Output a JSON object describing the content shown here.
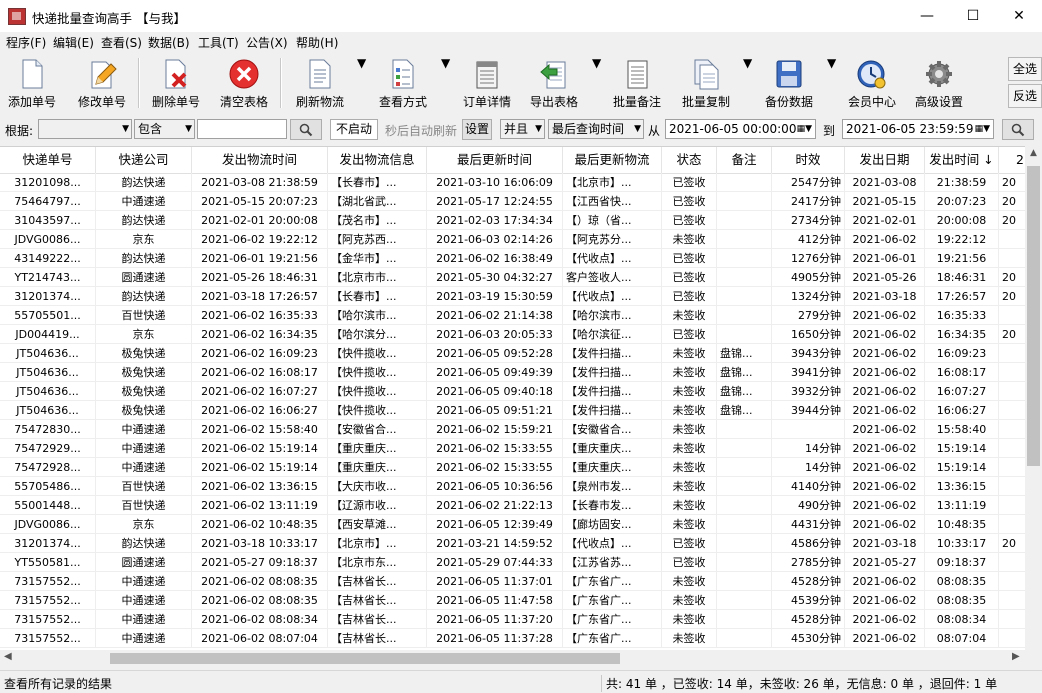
{
  "window": {
    "title": "快递批量查询高手 【与我】",
    "minimize": "—",
    "maximize": "☐",
    "close": "✕"
  },
  "menu": [
    "程序(F)",
    "编辑(E)",
    "查看(S)",
    "数据(B)",
    "工具(T)",
    "公告(X)",
    "帮助(H)"
  ],
  "toolbar": [
    {
      "id": "add",
      "label": "添加单号",
      "icon": "add-document-icon"
    },
    {
      "id": "edit",
      "label": "修改单号",
      "icon": "edit-pencil-icon"
    },
    {
      "id": "delete",
      "label": "删除单号",
      "icon": "delete-document-icon"
    },
    {
      "id": "clear",
      "label": "清空表格",
      "icon": "clear-table-icon"
    },
    {
      "id": "refresh",
      "label": "刷新物流",
      "icon": "refresh-document-icon"
    },
    {
      "id": "view",
      "label": "查看方式",
      "icon": "view-mode-icon"
    },
    {
      "id": "details",
      "label": "订单详情",
      "icon": "order-details-icon"
    },
    {
      "id": "export",
      "label": "导出表格",
      "icon": "export-table-icon"
    },
    {
      "id": "batchnote",
      "label": "批量备注",
      "icon": "batch-note-icon"
    },
    {
      "id": "batchcopy",
      "label": "批量复制",
      "icon": "batch-copy-icon"
    },
    {
      "id": "backup",
      "label": "备份数据",
      "icon": "backup-disk-icon"
    },
    {
      "id": "member",
      "label": "会员中心",
      "icon": "member-clock-icon"
    },
    {
      "id": "settings",
      "label": "高级设置",
      "icon": "gear-icon"
    }
  ],
  "side_buttons": {
    "select_all": "全选",
    "invert": "反选"
  },
  "filter": {
    "basis_label": "根据:",
    "basis_value": "",
    "match_value": "包含",
    "search_value": "",
    "auto_refresh_button": "不启动",
    "auto_refresh_text": "秒后自动刷新",
    "settings_button": "设置",
    "logic_value": "并且",
    "time_field_value": "最后查询时间",
    "from_label": "从",
    "from_value": "2021-06-05 00:00:00",
    "to_label": "到",
    "to_value": "2021-06-05 23:59:59"
  },
  "table": {
    "columns": [
      "快递单号",
      "快递公司",
      "发出物流时间",
      "发出物流信息",
      "最后更新时间",
      "最后更新物流",
      "状态",
      "备注",
      "时效",
      "发出日期",
      "发出时间 ↓",
      "2"
    ],
    "rows": [
      [
        "31201098...",
        "韵达快递",
        "2021-03-08 21:38:59",
        "【长春市】...",
        "2021-03-10 16:06:09",
        "【北京市】...",
        "已签收",
        "",
        "2547分钟",
        "2021-03-08",
        "21:38:59",
        "20"
      ],
      [
        "75464797...",
        "中通速递",
        "2021-05-15 20:07:23",
        "【湖北省武...",
        "2021-05-17 12:24:55",
        "【江西省快...",
        "已签收",
        "",
        "2417分钟",
        "2021-05-15",
        "20:07:23",
        "20"
      ],
      [
        "31043597...",
        "韵达快递",
        "2021-02-01 20:00:08",
        "【茂名市】...",
        "2021-02-03 17:34:34",
        "【）琼（省...",
        "已签收",
        "",
        "2734分钟",
        "2021-02-01",
        "20:00:08",
        "20"
      ],
      [
        "JDVG0086...",
        "京东",
        "2021-06-02 19:22:12",
        "【阿克苏西...",
        "2021-06-03 02:14:26",
        "【阿克苏分...",
        "未签收",
        "",
        "412分钟",
        "2021-06-02",
        "19:22:12",
        ""
      ],
      [
        "43149222...",
        "韵达快递",
        "2021-06-01 19:21:56",
        "【金华市】...",
        "2021-06-02 16:38:49",
        "【代收点】...",
        "已签收",
        "",
        "1276分钟",
        "2021-06-01",
        "19:21:56",
        ""
      ],
      [
        "YT214743...",
        "圆通速递",
        "2021-05-26 18:46:31",
        "【北京市市...",
        "2021-05-30 04:32:27",
        "客户签收人...",
        "已签收",
        "",
        "4905分钟",
        "2021-05-26",
        "18:46:31",
        "20"
      ],
      [
        "31201374...",
        "韵达快递",
        "2021-03-18 17:26:57",
        "【长春市】...",
        "2021-03-19 15:30:59",
        "【代收点】...",
        "已签收",
        "",
        "1324分钟",
        "2021-03-18",
        "17:26:57",
        "20"
      ],
      [
        "55705501...",
        "百世快递",
        "2021-06-02 16:35:33",
        "【哈尔滨市...",
        "2021-06-02 21:14:38",
        "【哈尔滨市...",
        "未签收",
        "",
        "279分钟",
        "2021-06-02",
        "16:35:33",
        ""
      ],
      [
        "JD004419...",
        "京东",
        "2021-06-02 16:34:35",
        "【哈尔滨分...",
        "2021-06-03 20:05:33",
        "【哈尔滨征...",
        "已签收",
        "",
        "1650分钟",
        "2021-06-02",
        "16:34:35",
        "20"
      ],
      [
        "JT504636...",
        "极兔快递",
        "2021-06-02 16:09:23",
        "【快件揽收...",
        "2021-06-05 09:52:28",
        "【发件扫描...",
        "未签收",
        "盘锦...",
        "3943分钟",
        "2021-06-02",
        "16:09:23",
        ""
      ],
      [
        "JT504636...",
        "极兔快递",
        "2021-06-02 16:08:17",
        "【快件揽收...",
        "2021-06-05 09:49:39",
        "【发件扫描...",
        "未签收",
        "盘锦...",
        "3941分钟",
        "2021-06-02",
        "16:08:17",
        ""
      ],
      [
        "JT504636...",
        "极兔快递",
        "2021-06-02 16:07:27",
        "【快件揽收...",
        "2021-06-05 09:40:18",
        "【发件扫描...",
        "未签收",
        "盘锦...",
        "3932分钟",
        "2021-06-02",
        "16:07:27",
        ""
      ],
      [
        "JT504636...",
        "极兔快递",
        "2021-06-02 16:06:27",
        "【快件揽收...",
        "2021-06-05 09:51:21",
        "【发件扫描...",
        "未签收",
        "盘锦...",
        "3944分钟",
        "2021-06-02",
        "16:06:27",
        ""
      ],
      [
        "75472830...",
        "中通速递",
        "2021-06-02 15:58:40",
        "【安徽省合...",
        "2021-06-02 15:59:21",
        "【安徽省合...",
        "未签收",
        "",
        "",
        "2021-06-02",
        "15:58:40",
        ""
      ],
      [
        "75472929...",
        "中通速递",
        "2021-06-02 15:19:14",
        "【重庆重庆...",
        "2021-06-02 15:33:55",
        "【重庆重庆...",
        "未签收",
        "",
        "14分钟",
        "2021-06-02",
        "15:19:14",
        ""
      ],
      [
        "75472928...",
        "中通速递",
        "2021-06-02 15:19:14",
        "【重庆重庆...",
        "2021-06-02 15:33:55",
        "【重庆重庆...",
        "未签收",
        "",
        "14分钟",
        "2021-06-02",
        "15:19:14",
        ""
      ],
      [
        "55705486...",
        "百世快递",
        "2021-06-02 13:36:15",
        "【大庆市收...",
        "2021-06-05 10:36:56",
        "【泉州市发...",
        "未签收",
        "",
        "4140分钟",
        "2021-06-02",
        "13:36:15",
        ""
      ],
      [
        "55001448...",
        "百世快递",
        "2021-06-02 13:11:19",
        "【辽源市收...",
        "2021-06-02 21:22:13",
        "【长春市发...",
        "未签收",
        "",
        "490分钟",
        "2021-06-02",
        "13:11:19",
        ""
      ],
      [
        "JDVG0086...",
        "京东",
        "2021-06-02 10:48:35",
        "【西安草滩...",
        "2021-06-05 12:39:49",
        "【廊坊固安...",
        "未签收",
        "",
        "4431分钟",
        "2021-06-02",
        "10:48:35",
        ""
      ],
      [
        "31201374...",
        "韵达快递",
        "2021-03-18 10:33:17",
        "【北京市】...",
        "2021-03-21 14:59:52",
        "【代收点】...",
        "已签收",
        "",
        "4586分钟",
        "2021-03-18",
        "10:33:17",
        "20"
      ],
      [
        "YT550581...",
        "圆通速递",
        "2021-05-27 09:18:37",
        "【北京市东...",
        "2021-05-29 07:44:33",
        "【江苏省苏...",
        "已签收",
        "",
        "2785分钟",
        "2021-05-27",
        "09:18:37",
        ""
      ],
      [
        "73157552...",
        "中通速递",
        "2021-06-02 08:08:35",
        "【吉林省长...",
        "2021-06-05 11:37:01",
        "【广东省广...",
        "未签收",
        "",
        "4528分钟",
        "2021-06-02",
        "08:08:35",
        ""
      ],
      [
        "73157552...",
        "中通速递",
        "2021-06-02 08:08:35",
        "【吉林省长...",
        "2021-06-05 11:47:58",
        "【广东省广...",
        "未签收",
        "",
        "4539分钟",
        "2021-06-02",
        "08:08:35",
        ""
      ],
      [
        "73157552...",
        "中通速递",
        "2021-06-02 08:08:34",
        "【吉林省长...",
        "2021-06-05 11:37:20",
        "【广东省广...",
        "未签收",
        "",
        "4528分钟",
        "2021-06-02",
        "08:08:34",
        ""
      ],
      [
        "73157552...",
        "中通速递",
        "2021-06-02 08:07:04",
        "【吉林省长...",
        "2021-06-05 11:37:28",
        "【广东省广...",
        "未签收",
        "",
        "4530分钟",
        "2021-06-02",
        "08:07:04",
        ""
      ]
    ]
  },
  "status": {
    "left": "查看所有记录的结果",
    "right": "共: 41 单 ，已签收:  14 单，未签收:  26 单，无信息: 0 单 ，退回件: 1 单"
  }
}
